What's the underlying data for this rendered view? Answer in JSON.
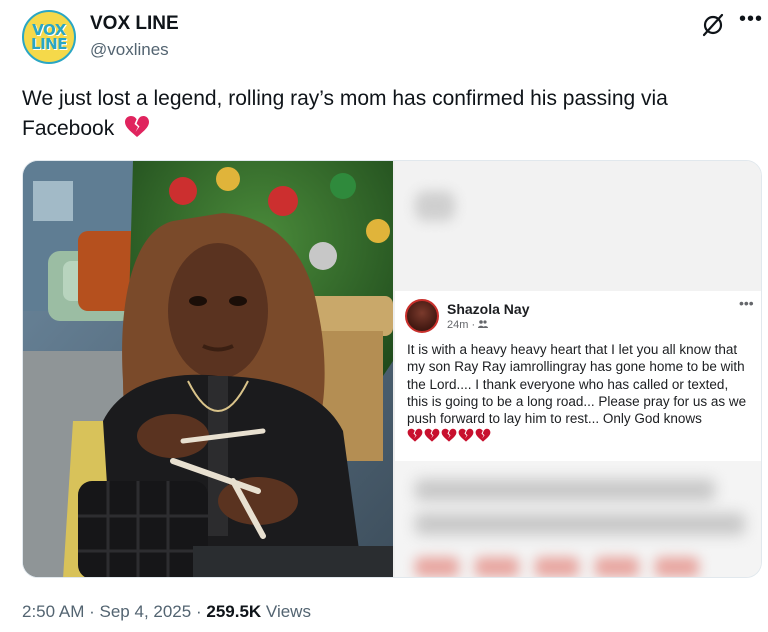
{
  "author": {
    "name": "VOX LINE",
    "handle": "@voxlines",
    "avatar_text": "VOX\nLINE"
  },
  "tweet": {
    "text": "We just lost a legend, rolling ray’s mom has confirmed his passing via Facebook",
    "emoji": "broken-heart"
  },
  "embedded_post": {
    "name": "Shazola Nay",
    "time": "24m",
    "privacy_icon": "friends-icon",
    "body": "It is with a heavy heavy heart that I let you all know that my son Ray Ray iamrollingray has gone home to be with the Lord.... I thank everyone who has called or texted, this is going to be a long road... Please pray for us as we push forward to lay him to rest... Only God knows",
    "broken_hearts": 5
  },
  "footer": {
    "time": "2:50 AM",
    "date": "Sep 4, 2025",
    "views_count": "259.5K",
    "views_label": "Views",
    "separator": "·"
  },
  "colors": {
    "text_primary": "#0f1419",
    "text_secondary": "#536471",
    "broken_heart": "#e0245e",
    "logo_yellow": "#f5d94a",
    "logo_blue": "#2aa6c4"
  }
}
